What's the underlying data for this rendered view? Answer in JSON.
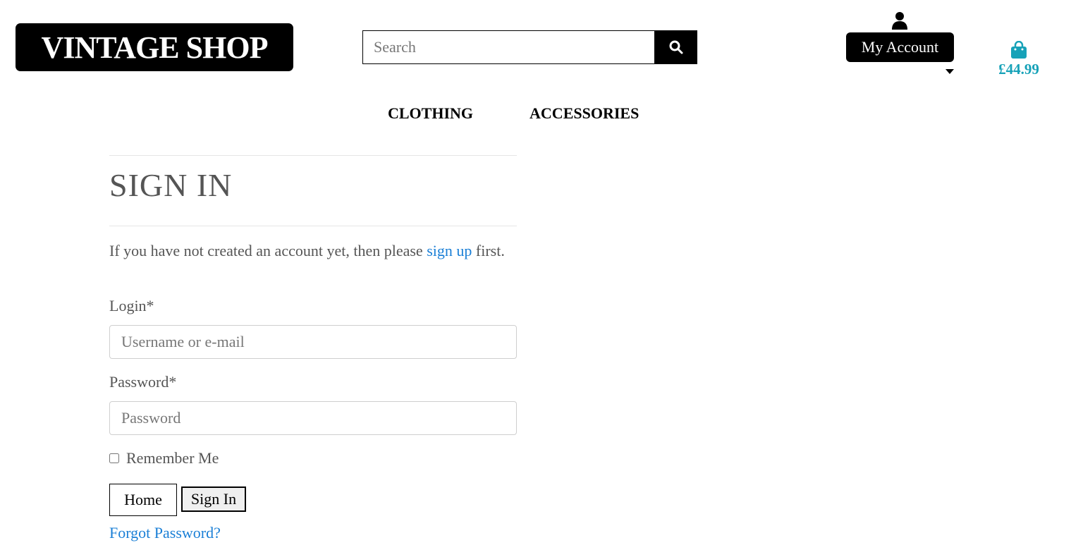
{
  "header": {
    "logo_text": "VINTAGE SHOP",
    "search_placeholder": "Search",
    "account_label": "My Account",
    "bag_total": "£44.99",
    "accent_color": "#17a2b8"
  },
  "nav": {
    "items": [
      "CLOTHING",
      "ACCESSORIES"
    ]
  },
  "signin": {
    "title": "SIGN IN",
    "intro_before": "If you have not created an account yet, then please ",
    "intro_link": "sign up",
    "intro_after": " first.",
    "login_label": "Login*",
    "login_placeholder": "Username or e-mail",
    "password_label": "Password*",
    "password_placeholder": "Password",
    "remember_label": "Remember Me",
    "remember_checked": false,
    "home_button": "Home",
    "signin_button": "Sign In",
    "forgot_link": "Forgot Password?",
    "link_color": "#1a7fd6"
  }
}
